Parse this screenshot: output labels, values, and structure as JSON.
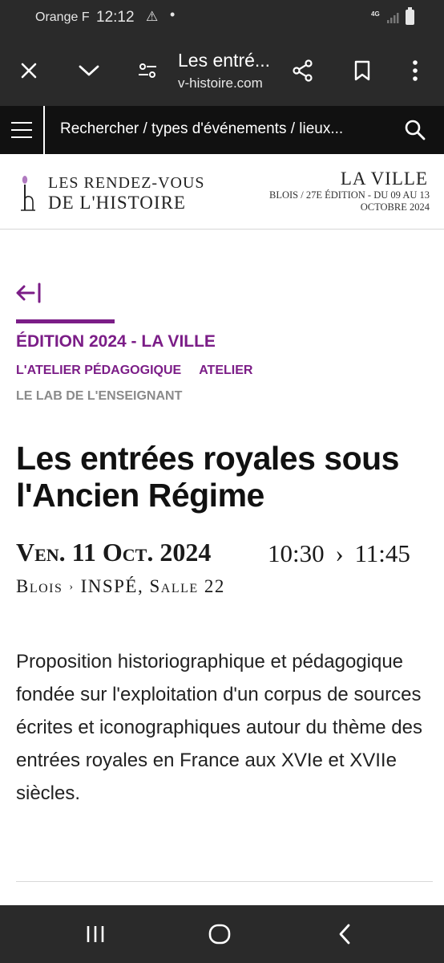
{
  "status_bar": {
    "carrier": "Orange F",
    "time": "12:12",
    "network": "4G"
  },
  "browser": {
    "tab_title": "Les entré...",
    "url": "v-histoire.com",
    "icons": [
      "close-icon",
      "chevron-down-icon",
      "page-settings-icon",
      "share-icon",
      "bookmark-icon",
      "more-vert-icon"
    ]
  },
  "search": {
    "query": "Rechercher / types d'événements / lieux..."
  },
  "brand": {
    "logo_line1": "Les Rendez-vous",
    "logo_line2": "de l'Histoire",
    "city": "La Ville",
    "edition_line1": "Blois / 27e édition - du 09 au 13",
    "edition_line2": "octobre 2024"
  },
  "event": {
    "edition_tag": "ÉDITION 2024 - LA VILLE",
    "category_1": "L'ATELIER PÉDAGOGIQUE",
    "category_2": "ATELIER",
    "category_3": "LE LAB DE L'ENSEIGNANT",
    "title": "Les entrées royales sous l'Ancien Régime",
    "date": "Ven. 11 Oct. 2024",
    "time_start": "10:30",
    "time_end": "11:45",
    "city": "Blois",
    "venue": "INSPÉ, Salle 22",
    "description": "Proposition historiographique et pédagogique fondée sur l'exploitation d'un corpus de sources écrites et iconographiques autour du thème des entrées royales en France aux XVIe et XVIIe siècles."
  },
  "colors": {
    "accent": "#7b1d87",
    "muted": "#8a8a8a",
    "chrome": "#2a2a2a",
    "searchbar": "#111111"
  }
}
